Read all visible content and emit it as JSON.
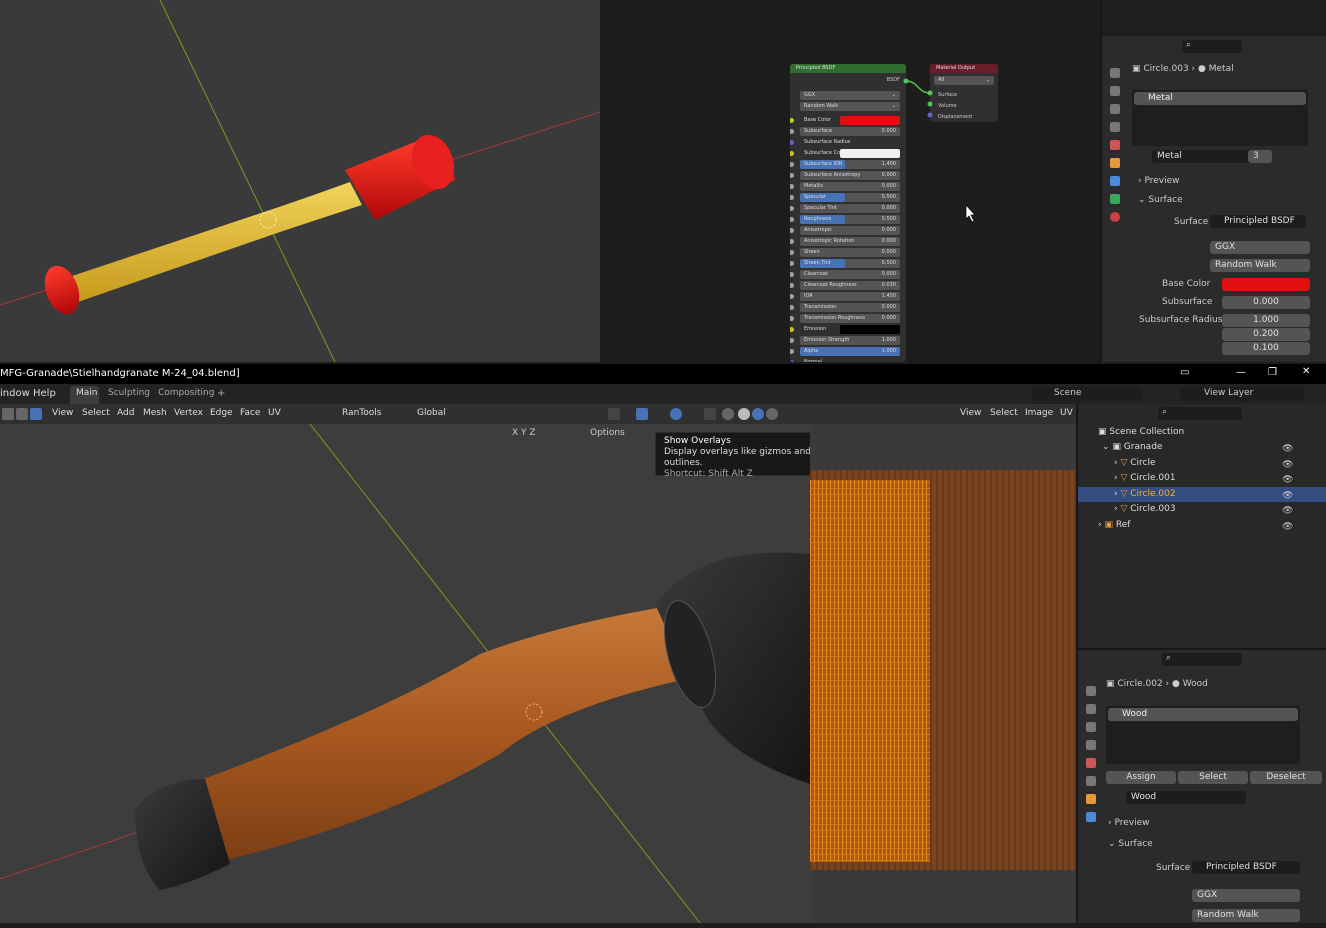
{
  "top_node_editor": {
    "bsdf_title": "Principled BSDF",
    "bsdf_output": "BSDF",
    "dist": "GGX",
    "sss_method": "Random Walk",
    "inputs": [
      {
        "label": "Base Color",
        "value": "",
        "kind": "color",
        "color": "#e01010"
      },
      {
        "label": "Subsurface",
        "value": "0.000",
        "kind": "value"
      },
      {
        "label": "Subsurface Radius",
        "value": "",
        "kind": "vec"
      },
      {
        "label": "Subsurface Color",
        "value": "",
        "kind": "color",
        "color": "#f0f0f0"
      },
      {
        "label": "Subsurface IOR",
        "value": "1.400",
        "kind": "blue"
      },
      {
        "label": "Subsurface Anisotropy",
        "value": "0.000",
        "kind": "value"
      },
      {
        "label": "Metallic",
        "value": "0.000",
        "kind": "value"
      },
      {
        "label": "Specular",
        "value": "0.500",
        "kind": "blue"
      },
      {
        "label": "Specular Tint",
        "value": "0.000",
        "kind": "value"
      },
      {
        "label": "Roughness",
        "value": "0.500",
        "kind": "blue"
      },
      {
        "label": "Anisotropic",
        "value": "0.000",
        "kind": "value"
      },
      {
        "label": "Anisotropic Rotation",
        "value": "0.000",
        "kind": "value"
      },
      {
        "label": "Sheen",
        "value": "0.000",
        "kind": "value"
      },
      {
        "label": "Sheen Tint",
        "value": "0.500",
        "kind": "blue"
      },
      {
        "label": "Clearcoat",
        "value": "0.000",
        "kind": "value"
      },
      {
        "label": "Clearcoat Roughness",
        "value": "0.030",
        "kind": "value"
      },
      {
        "label": "IOR",
        "value": "1.450",
        "kind": "value"
      },
      {
        "label": "Transmission",
        "value": "0.000",
        "kind": "value"
      },
      {
        "label": "Transmission Roughness",
        "value": "0.000",
        "kind": "value"
      },
      {
        "label": "Emission",
        "value": "",
        "kind": "color",
        "color": "#000000"
      },
      {
        "label": "Emission Strength",
        "value": "1.000",
        "kind": "value"
      },
      {
        "label": "Alpha",
        "value": "1.000",
        "kind": "full"
      },
      {
        "label": "Normal",
        "value": "",
        "kind": "plain"
      }
    ],
    "output_title": "Material Output",
    "output_target": "All",
    "output_sockets": [
      "Surface",
      "Volume",
      "Displacement"
    ]
  },
  "top_props": {
    "object": "Circle.003",
    "material": "Metal",
    "slot": "Metal",
    "users": "3",
    "preview": "Preview",
    "surface_header": "Surface",
    "surface_label": "Surface",
    "surface_value": "Principled BSDF",
    "dist": "GGX",
    "sss": "Random Walk",
    "base_color_label": "Base Color",
    "base_color": "#e01010",
    "subsurface_label": "Subsurface",
    "subsurface_value": "0.000",
    "radius_label": "Subsurface Radius",
    "radius": [
      "1.000",
      "0.200",
      "0.100"
    ]
  },
  "titlebar": {
    "title": "MFG-Granade\\Stielhandgranate M-24_04.blend]"
  },
  "menubar": {
    "items": [
      "indow",
      "Help"
    ],
    "workspaces": [
      "Main",
      "Sculpting",
      "Compositing"
    ],
    "add_ws": "+",
    "scene": "Scene",
    "view_layer": "View Layer"
  },
  "toolbar": {
    "menus": [
      "View",
      "Select",
      "Add",
      "Mesh",
      "Vertex",
      "Edge",
      "Face",
      "UV"
    ],
    "rantools": "RanTools",
    "orientation": "Global",
    "axes": [
      "X",
      "Y",
      "Z"
    ],
    "options": "Options"
  },
  "uv_header": {
    "menus": [
      "View",
      "Select",
      "Image",
      "UV"
    ]
  },
  "tooltip": {
    "title": "Show Overlays",
    "desc": "Display overlays like gizmos and outlines.",
    "shortcut": "Shortcut: Shift Alt Z"
  },
  "outliner": {
    "root": "Scene Collection",
    "collection": "Granade",
    "items": [
      "Circle",
      "Circle.001",
      "Circle.002",
      "Circle.003"
    ],
    "selected": 2,
    "ref": "Ref"
  },
  "props": {
    "object": "Circle.002",
    "material": "Wood",
    "slot": "Wood",
    "assign": "Assign",
    "select": "Select",
    "deselect": "Deselect",
    "preview": "Preview",
    "surface_header": "Surface",
    "surface_label": "Surface",
    "surface_value": "Principled BSDF",
    "dist": "GGX",
    "sss": "Random Walk"
  },
  "colors": {
    "accent": "#4772b3",
    "selected_row": "#334d80",
    "wood": "#b0642a",
    "red": "#e01010",
    "yellow": "#e8c23a"
  }
}
